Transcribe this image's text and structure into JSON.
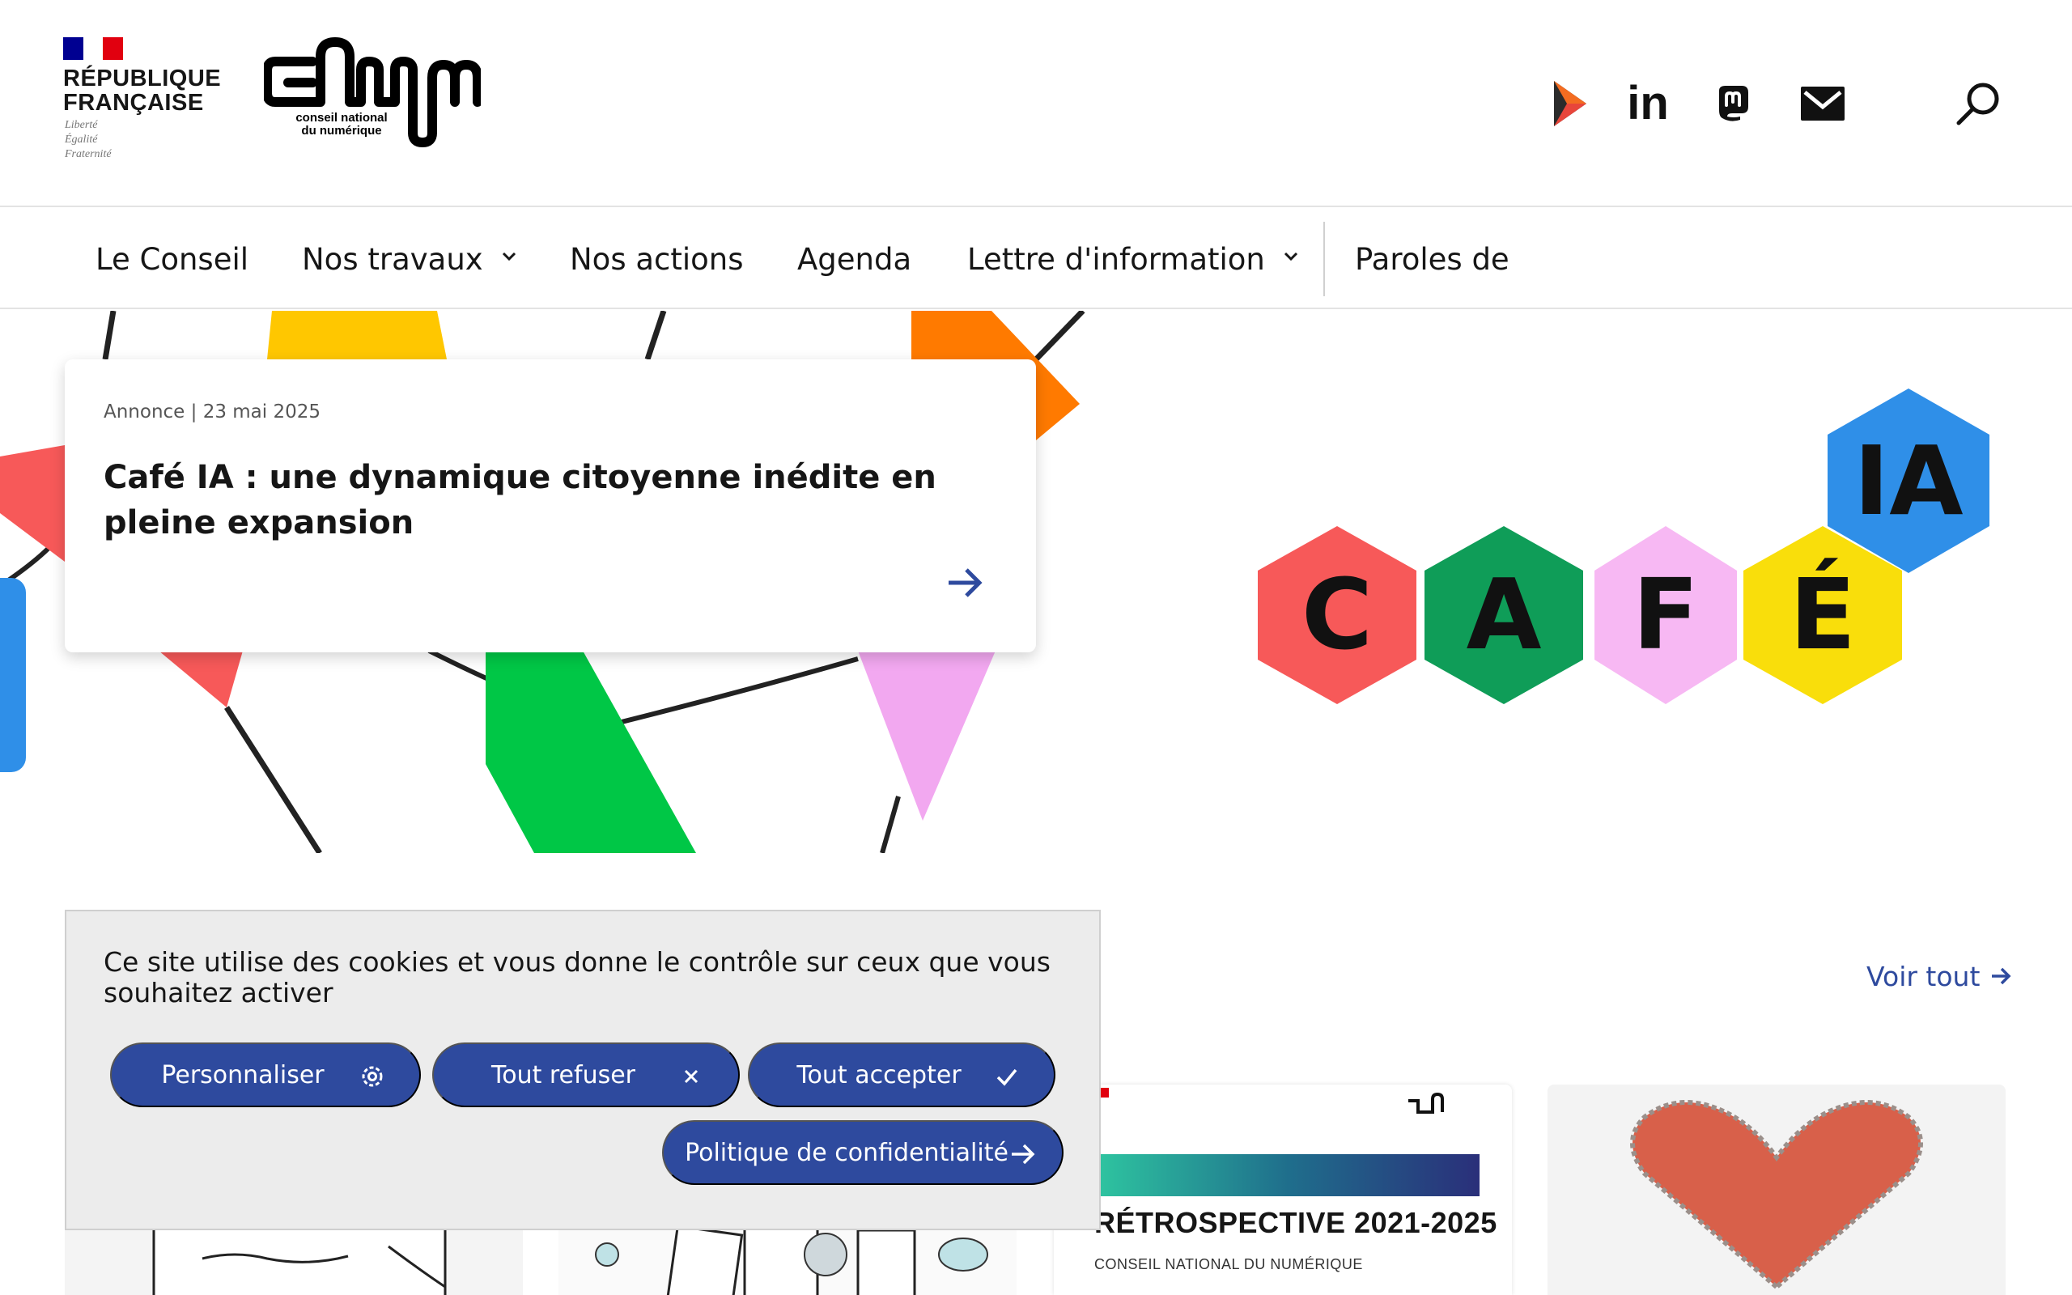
{
  "header": {
    "republique_lines": [
      "RÉPUBLIQUE",
      "FRANÇAISE"
    ],
    "motto_lines": [
      "Liberté",
      "Égalité",
      "Fraternité"
    ],
    "cnnum_sub_lines": [
      "conseil national",
      "du numérique"
    ],
    "social_icons": [
      "play-icon",
      "linkedin-icon",
      "mastodon-icon",
      "mail-icon"
    ],
    "linkedin_text": "in",
    "search_icon": "search-icon",
    "flag_colors": [
      "#000091",
      "#ffffff",
      "#e1000f"
    ]
  },
  "nav": {
    "items": [
      {
        "label": "Le Conseil",
        "dropdown": false
      },
      {
        "label": "Nos travaux",
        "dropdown": true
      },
      {
        "label": "Nos actions",
        "dropdown": false
      },
      {
        "label": "Agenda",
        "dropdown": false
      },
      {
        "label": "Lettre d'information",
        "dropdown": true
      },
      {
        "label": "Paroles de",
        "dropdown": false
      }
    ]
  },
  "hero": {
    "meta": "Annonce | 23 mai 2025",
    "title": "Café IA : une dynamique citoyenne inédite en pleine expansion",
    "logo_letters": [
      "C",
      "A",
      "F",
      "É",
      "IA"
    ],
    "logo_colors": [
      "#f75959",
      "#0f9d58",
      "#f7b8f3",
      "#f9de0b",
      "#2f8fe8"
    ]
  },
  "section": {
    "voir_tout": "Voir tout",
    "retro_title": "RÉTROSPECTIVE 2021-2025",
    "retro_sub": "CONSEIL NATIONAL DU NUMÉRIQUE"
  },
  "cookie": {
    "text": "Ce site utilise des cookies et vous donne le contrôle sur ceux que vous souhaitez activer",
    "btn_personnaliser": "Personnaliser",
    "btn_refuser": "Tout refuser",
    "btn_accepter": "Tout accepter",
    "btn_politique": "Politique de confidentialité"
  },
  "accent_color": "#2e4a9e"
}
